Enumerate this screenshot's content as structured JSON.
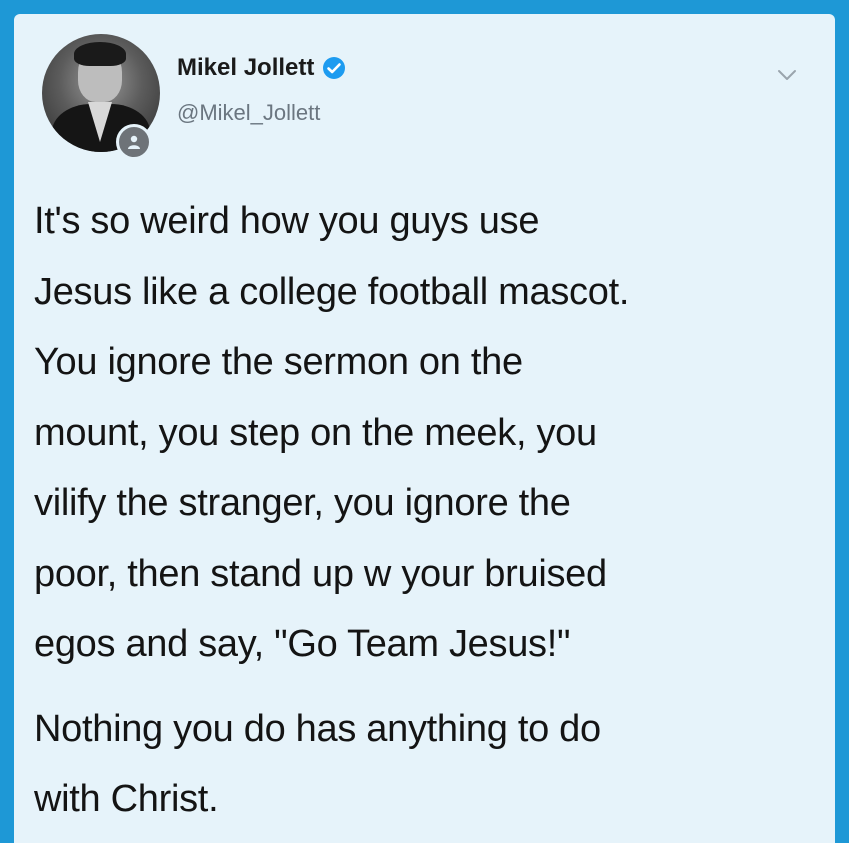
{
  "tweet": {
    "author_name": "Mikel Jollett",
    "author_handle": "@Mikel_Jollett",
    "verified": true,
    "paragraph1_lines": [
      "It's so weird how you guys use",
      "Jesus like a college football mascot.",
      "You ignore the sermon on the",
      "mount, you step on the meek, you",
      "vilify the stranger, you ignore the",
      "poor, then stand up w your bruised",
      "egos and say, \"Go Team Jesus!\""
    ],
    "paragraph2_lines": [
      "Nothing you do has anything to do",
      "with Christ."
    ]
  },
  "icons": {
    "verified": "verified-badge-icon",
    "menu": "chevron-down-icon",
    "badge": "person-badge-icon"
  },
  "colors": {
    "frame": "#1e98d6",
    "card_background": "#e6f3fa",
    "verified_blue": "#1d9bf0",
    "text": "#141414",
    "handle": "#6b7680"
  }
}
